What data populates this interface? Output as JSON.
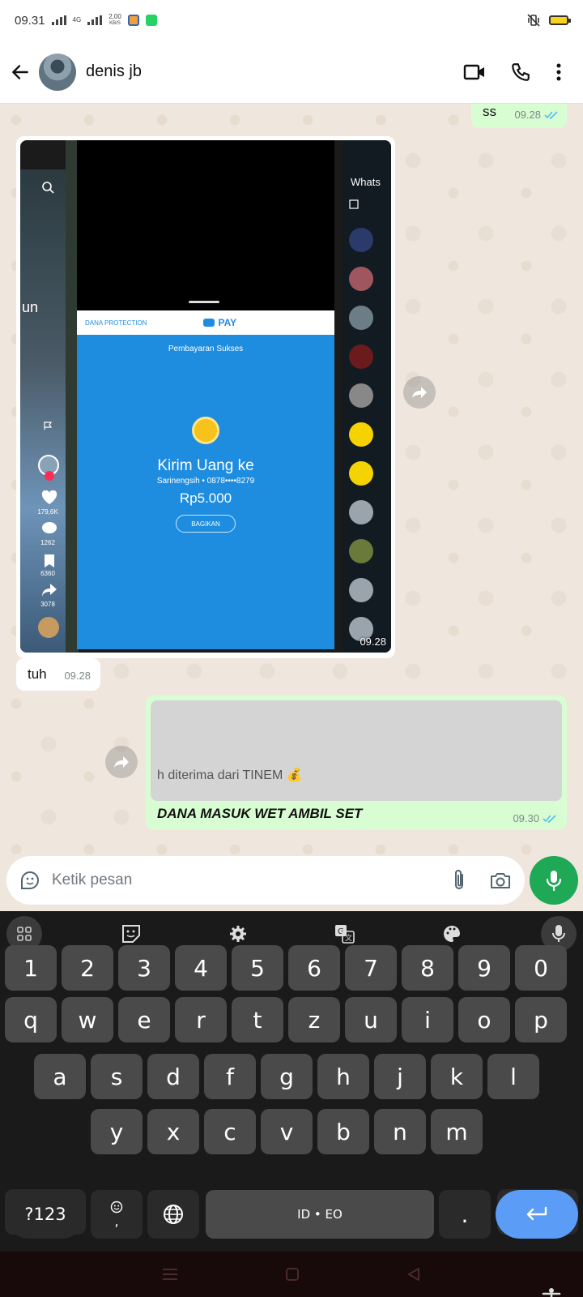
{
  "status_bar": {
    "time": "09.31",
    "network_speed": "2,00",
    "speed_unit": "KB/S",
    "network_type": "4G"
  },
  "header": {
    "contact_name": "denis jb",
    "icons": [
      "back-arrow-icon",
      "video-call-icon",
      "phone-icon",
      "more-vert-icon"
    ]
  },
  "messages": [
    {
      "type": "outgoing",
      "text": "ss",
      "time": "09.28",
      "status": "read"
    },
    {
      "type": "incoming-image",
      "time": "09.28",
      "screenshot": {
        "tiktok": {
          "label": "un",
          "likes": "179,6K",
          "comments": "1262",
          "bookmarks": "6360",
          "shares": "3078"
        },
        "dana": {
          "brand": "DANA PROTECTION",
          "pay": "PAY",
          "title": "Pembayaran Sukses",
          "heading": "Kirim Uang ke",
          "recipient": "Sarinengsih • 0878••••8279",
          "amount": "Rp5.000",
          "share_button": "BAGIKAN"
        },
        "whatsapp_list_title": "Whats"
      }
    },
    {
      "type": "incoming",
      "text": "tuh",
      "time": "09.28"
    },
    {
      "type": "outgoing-reply",
      "quoted_text": "h diterima dari TINEM 💰",
      "text": "DANA MASUK WET AMBIL SET",
      "time": "09.30",
      "status": "read"
    }
  ],
  "composer": {
    "placeholder": "Ketik pesan"
  },
  "keyboard": {
    "rows": [
      [
        "1",
        "2",
        "3",
        "4",
        "5",
        "6",
        "7",
        "8",
        "9",
        "0"
      ],
      [
        "q",
        "w",
        "e",
        "r",
        "t",
        "z",
        "u",
        "i",
        "o",
        "p"
      ],
      [
        "a",
        "s",
        "d",
        "f",
        "g",
        "h",
        "j",
        "k",
        "l"
      ],
      [
        "y",
        "x",
        "c",
        "v",
        "b",
        "n",
        "m"
      ]
    ],
    "symbols_key": "?123",
    "emoji_comma": ",",
    "space_label": "ID • EO",
    "period": "."
  },
  "colors": {
    "outgoing_bubble": "#d9fdd3",
    "incoming_bubble": "#ffffff",
    "whatsapp_green": "#1fa855",
    "read_tick": "#53bdeb",
    "dana_blue": "#1e8de0",
    "keyboard_bg": "#1a1a1a",
    "enter_key": "#5b9df6"
  }
}
